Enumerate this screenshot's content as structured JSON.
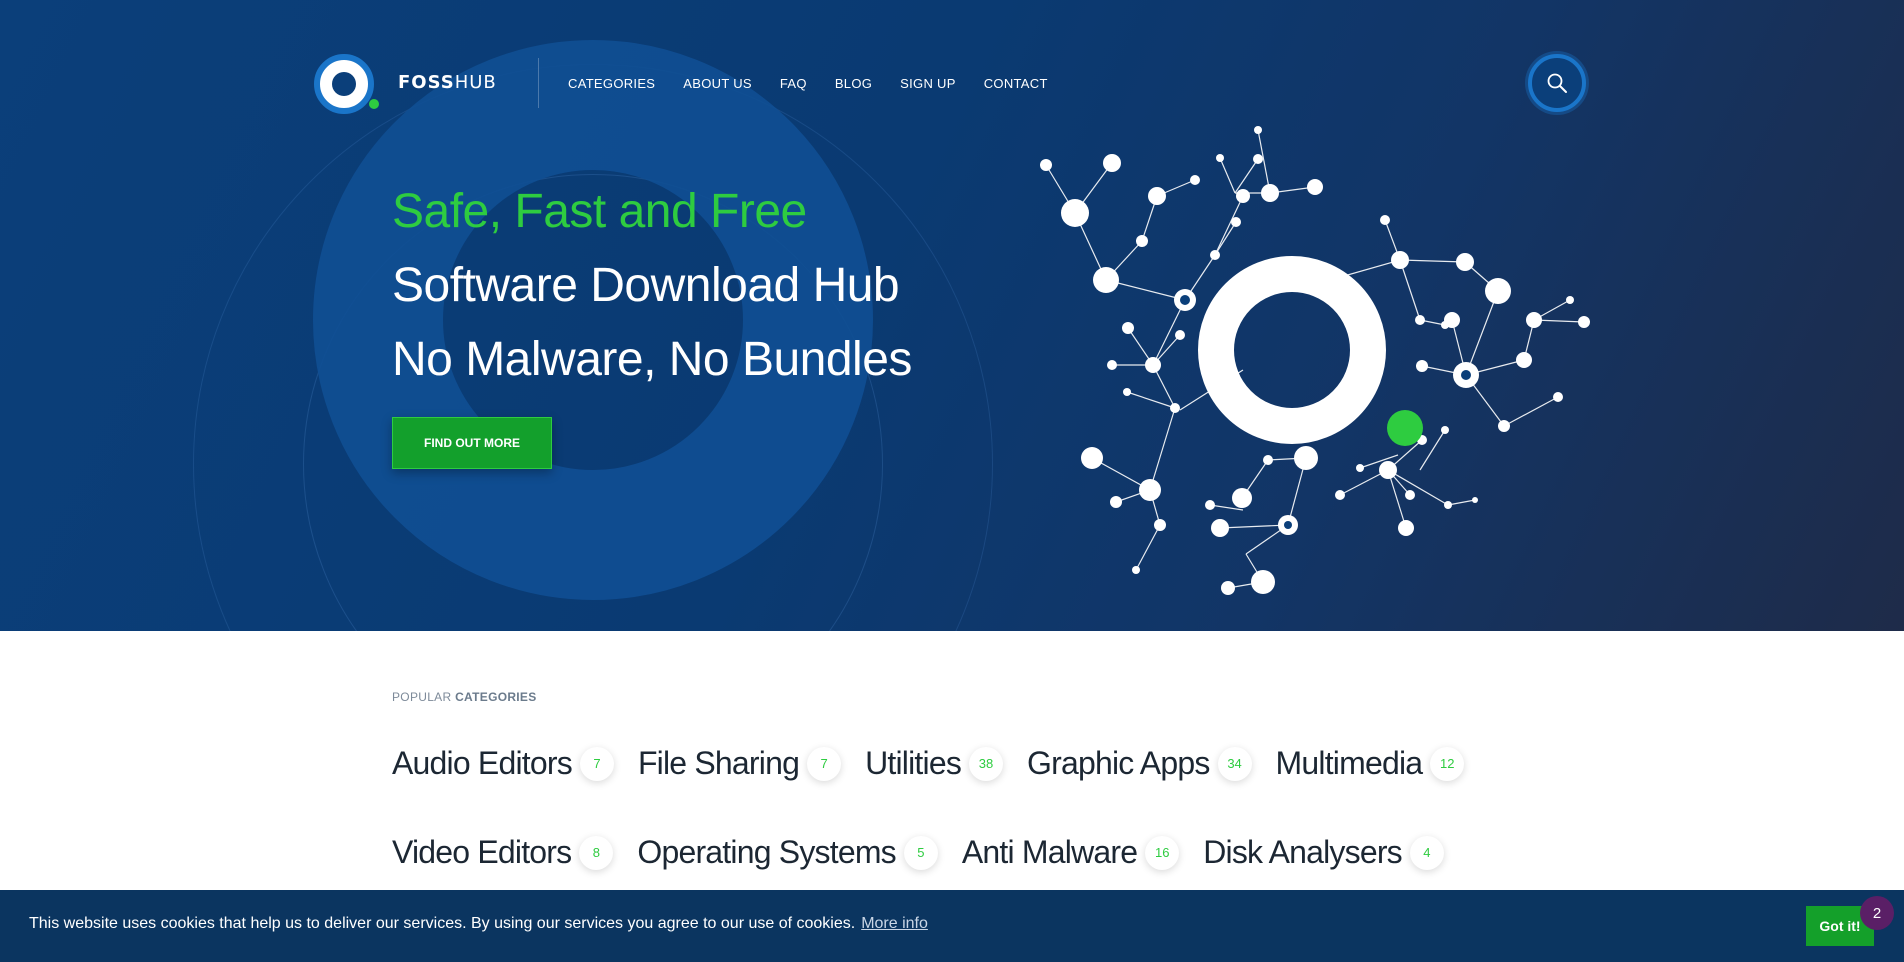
{
  "header": {
    "logo_bold": "FOSS",
    "logo_light": "HUB",
    "nav": [
      "CATEGORIES",
      "ABOUT US",
      "FAQ",
      "BLOG",
      "SIGN UP",
      "CONTACT"
    ]
  },
  "hero": {
    "line1": "Safe, Fast and Free",
    "line2": "Software Download Hub",
    "line3": "No Malware, No Bundles",
    "cta": "FIND OUT MORE"
  },
  "categories": {
    "label_light": "POPULAR ",
    "label_bold": "CATEGORIES",
    "row1": [
      {
        "name": "Audio Editors",
        "count": "7"
      },
      {
        "name": "File Sharing",
        "count": "7"
      },
      {
        "name": "Utilities",
        "count": "38"
      },
      {
        "name": "Graphic Apps",
        "count": "34"
      },
      {
        "name": "Multimedia",
        "count": "12"
      }
    ],
    "row2": [
      {
        "name": "Video Editors",
        "count": "8"
      },
      {
        "name": "Operating Systems",
        "count": "5"
      },
      {
        "name": "Anti Malware",
        "count": "16"
      },
      {
        "name": "Disk Analysers",
        "count": "4"
      }
    ]
  },
  "cookie": {
    "text": "This website uses cookies that help us to deliver our services. By using our services you agree to our use of cookies.",
    "link": "More info",
    "button": "Got it!",
    "badge": "2"
  },
  "colors": {
    "brand_blue": "#0b3f7a",
    "accent_green": "#2ecc40",
    "cookie_bar": "#0b3560"
  },
  "icons": {
    "search": "search-icon"
  }
}
